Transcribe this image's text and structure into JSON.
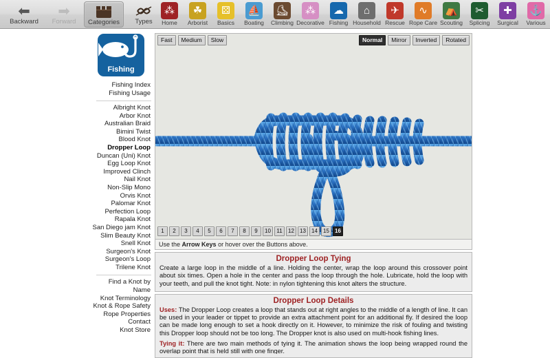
{
  "toolbar": {
    "nav": [
      {
        "label": "Backward",
        "icon": "left-arrow-icon",
        "state": "enabled"
      },
      {
        "label": "Forward",
        "icon": "right-arrow-icon",
        "state": "disabled"
      },
      {
        "label": "Categories",
        "icon": "categories-icon",
        "state": "active"
      },
      {
        "label": "Types",
        "icon": "knot-types-icon",
        "state": "enabled"
      }
    ],
    "categories": [
      {
        "label": "Home",
        "color": "#9e2225",
        "glyph": "⁂"
      },
      {
        "label": "Arborist",
        "color": "#c8a220",
        "glyph": "☘"
      },
      {
        "label": "Basics",
        "color": "#e6c02a",
        "glyph": "⚄"
      },
      {
        "label": "Boating",
        "color": "#4a9bd1",
        "glyph": "⛵"
      },
      {
        "label": "Climbing",
        "color": "#6b4a30",
        "glyph": "⛸"
      },
      {
        "label": "Decorative",
        "color": "#d68fc4",
        "glyph": "⁂"
      },
      {
        "label": "Fishing",
        "color": "#1668ad",
        "glyph": "☁"
      },
      {
        "label": "Household",
        "color": "#6e6e6e",
        "glyph": "⌂"
      },
      {
        "label": "Rescue",
        "color": "#c0392b",
        "glyph": "✈"
      },
      {
        "label": "Rope Care",
        "color": "#e07b28",
        "glyph": "∿"
      },
      {
        "label": "Scouting",
        "color": "#3f7a43",
        "glyph": "⛺"
      },
      {
        "label": "Splicing",
        "color": "#1f5c30",
        "glyph": "✂"
      },
      {
        "label": "Surgical",
        "color": "#7e3fa3",
        "glyph": "✚"
      },
      {
        "label": "Various",
        "color": "#e06aa8",
        "glyph": "⚓"
      }
    ]
  },
  "sidebar": {
    "brand": {
      "label": "Fishing",
      "icon": "fish-hook-icon",
      "color": "#15629f"
    },
    "index_links": [
      "Fishing Index",
      "Fishing Usage"
    ],
    "knots": [
      "Albright Knot",
      "Arbor Knot",
      "Australian Braid",
      "Bimini Twist",
      "Blood Knot",
      "Dropper Loop",
      "Duncan (Uni) Knot",
      "Egg Loop Knot",
      "Improved Clinch",
      "Nail Knot",
      "Non-Slip Mono",
      "Orvis Knot",
      "Palomar Knot",
      "Perfection Loop",
      "Rapala Knot",
      "San Diego jam Knot",
      "Slim Beauty Knot",
      "Snell Knot",
      "Surgeon's Knot",
      "Surgeon's Loop",
      "Trilene Knot"
    ],
    "selected_knot": "Dropper Loop",
    "footer_links": [
      "Find a Knot by Name",
      "Knot Terminology",
      "Knot & Rope Safety",
      "Rope Properties",
      "Contact",
      "Knot Store"
    ]
  },
  "animation": {
    "speed_buttons": [
      "Fast",
      "Medium",
      "Slow"
    ],
    "speed_selected": "",
    "view_buttons": [
      "Normal",
      "Mirror",
      "Inverted",
      "Rotated"
    ],
    "view_selected": "Normal",
    "frames": [
      "1",
      "2",
      "3",
      "4",
      "5",
      "6",
      "7",
      "8",
      "9",
      "10",
      "11",
      "12",
      "13",
      "14",
      "15",
      "16"
    ],
    "frame_selected": "16",
    "image_alt": "blue-braided-rope-dropper-loop-knot",
    "rope_color": "#2a6fc0",
    "background_color": "#e6e7e2"
  },
  "hint": {
    "pre": "Use the ",
    "bold": "Arrow Keys",
    "post": " or hover over the Buttons above."
  },
  "tying": {
    "title": "Dropper Loop Tying",
    "body": "Create a large loop in the middle of a line. Holding the center, wrap the loop around this crossover point about six times. Open a hole in the center and pass the loop through the hole. Lubricate, hold the loop with your teeth, and pull the knot tight. Note: in nylon tightening this knot alters the structure."
  },
  "details": {
    "title": "Dropper Loop Details",
    "uses_label": "Uses:",
    "uses_body": " The Dropper Loop creates a loop that stands out at right angles to the middle of a length of line. It can be used in your leader or tippet to provide an extra attachment point for an additional fly. If desired the loop can be made long enough to set a hook directly on it. However, to minimize the risk of fouling and twisting this Dropper loop should not be too long. The Dropper knot is also used on multi-hook fishing lines.",
    "tying_label": "Tying it:",
    "tying_body": " There are two main methods of tying it. The animation shows the loop being wrapped round the overlap point that is held still with one finger."
  }
}
